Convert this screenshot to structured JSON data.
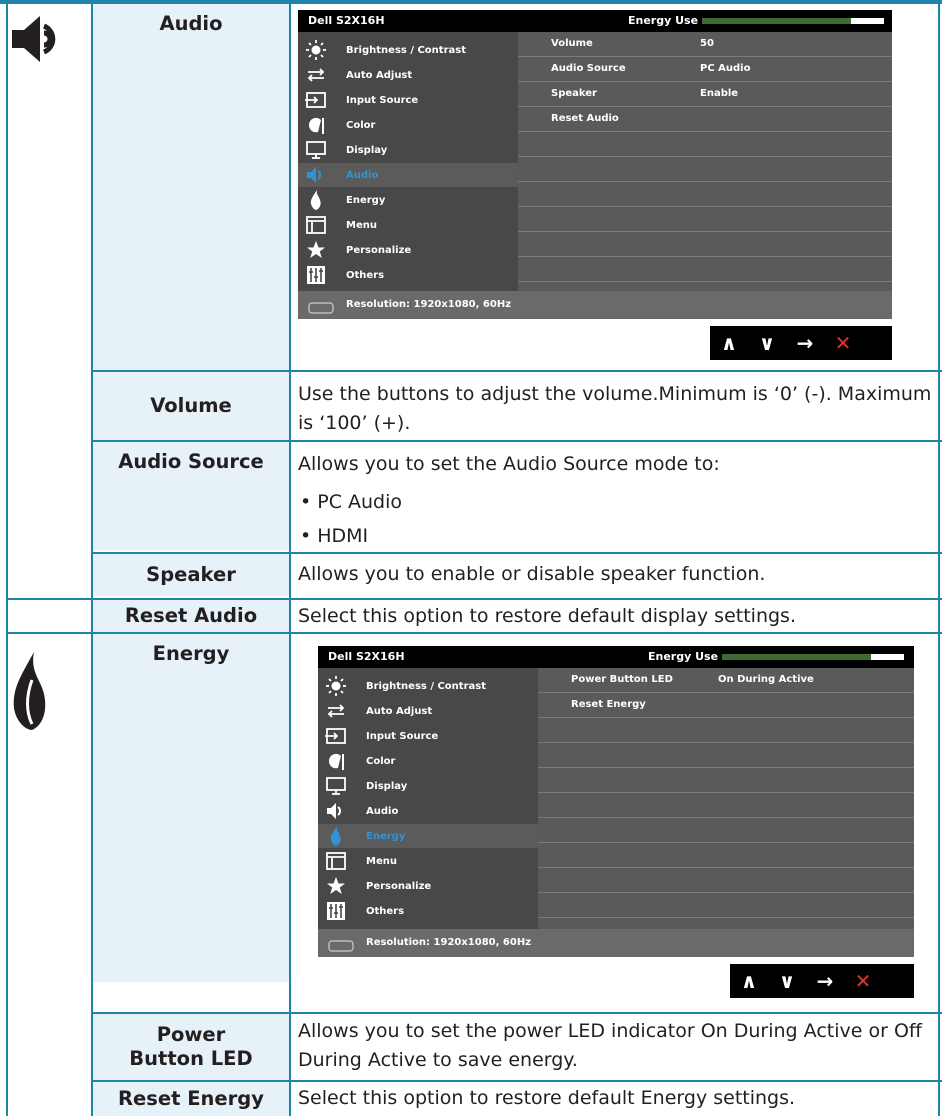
{
  "audio": {
    "heading": "Audio",
    "osd": {
      "brand": "Dell S2X16H",
      "energy_use_label": "Energy Use",
      "energy_use_level": 0.82,
      "menu": [
        "Brightness / Contrast",
        "Auto Adjust",
        "Input Source",
        "Color",
        "Display",
        "Audio",
        "Energy",
        "Menu",
        "Personalize",
        "Others"
      ],
      "selected": "Audio",
      "rows": [
        {
          "key": "Volume",
          "value": "50"
        },
        {
          "key": "Audio Source",
          "value": "PC Audio"
        },
        {
          "key": "Speaker",
          "value": "Enable"
        },
        {
          "key": "Reset Audio",
          "value": ""
        }
      ],
      "status": "Resolution: 1920x1080, 60Hz"
    },
    "items": [
      {
        "name": "Volume",
        "desc": "Use the buttons to adjust the volume.Minimum is ‘0’ (-). Maximum is ‘100’ (+)."
      },
      {
        "name": "Audio Source",
        "desc": "Allows you to set the Audio Source mode to:",
        "bullets": [
          "PC Audio",
          "HDMI"
        ]
      },
      {
        "name": "Speaker",
        "desc": "Allows you to enable or disable speaker function."
      },
      {
        "name": "Reset Audio",
        "desc": "Select this option to restore default display settings."
      }
    ]
  },
  "energy": {
    "heading": "Energy",
    "osd": {
      "brand": "Dell S2X16H",
      "energy_use_label": "Energy Use",
      "energy_use_level": 0.82,
      "menu": [
        "Brightness / Contrast",
        "Auto Adjust",
        "Input Source",
        "Color",
        "Display",
        "Audio",
        "Energy",
        "Menu",
        "Personalize",
        "Others"
      ],
      "selected": "Energy",
      "rows": [
        {
          "key": "Power Button LED",
          "value": "On During Active"
        },
        {
          "key": "Reset Energy",
          "value": ""
        }
      ],
      "status": "Resolution: 1920x1080, 60Hz"
    },
    "items": [
      {
        "name": "Power Button LED",
        "desc": "Allows you to set the power LED indicator On During Active or Off During Active to save energy."
      },
      {
        "name": "Reset Energy",
        "desc": "Select this option to restore default Energy settings."
      }
    ]
  },
  "nav_buttons": [
    "up-icon",
    "down-icon",
    "right-arrow-icon",
    "close-icon"
  ],
  "nav_glyphs": [
    "∧",
    "∨",
    "→",
    "✕"
  ],
  "colors": {
    "rule": "#1e84a8",
    "head_cell": "#e6f2f8",
    "selected_item": "#2f93d5",
    "energy_fill": "#3f6b32",
    "close": "#e0312d"
  }
}
